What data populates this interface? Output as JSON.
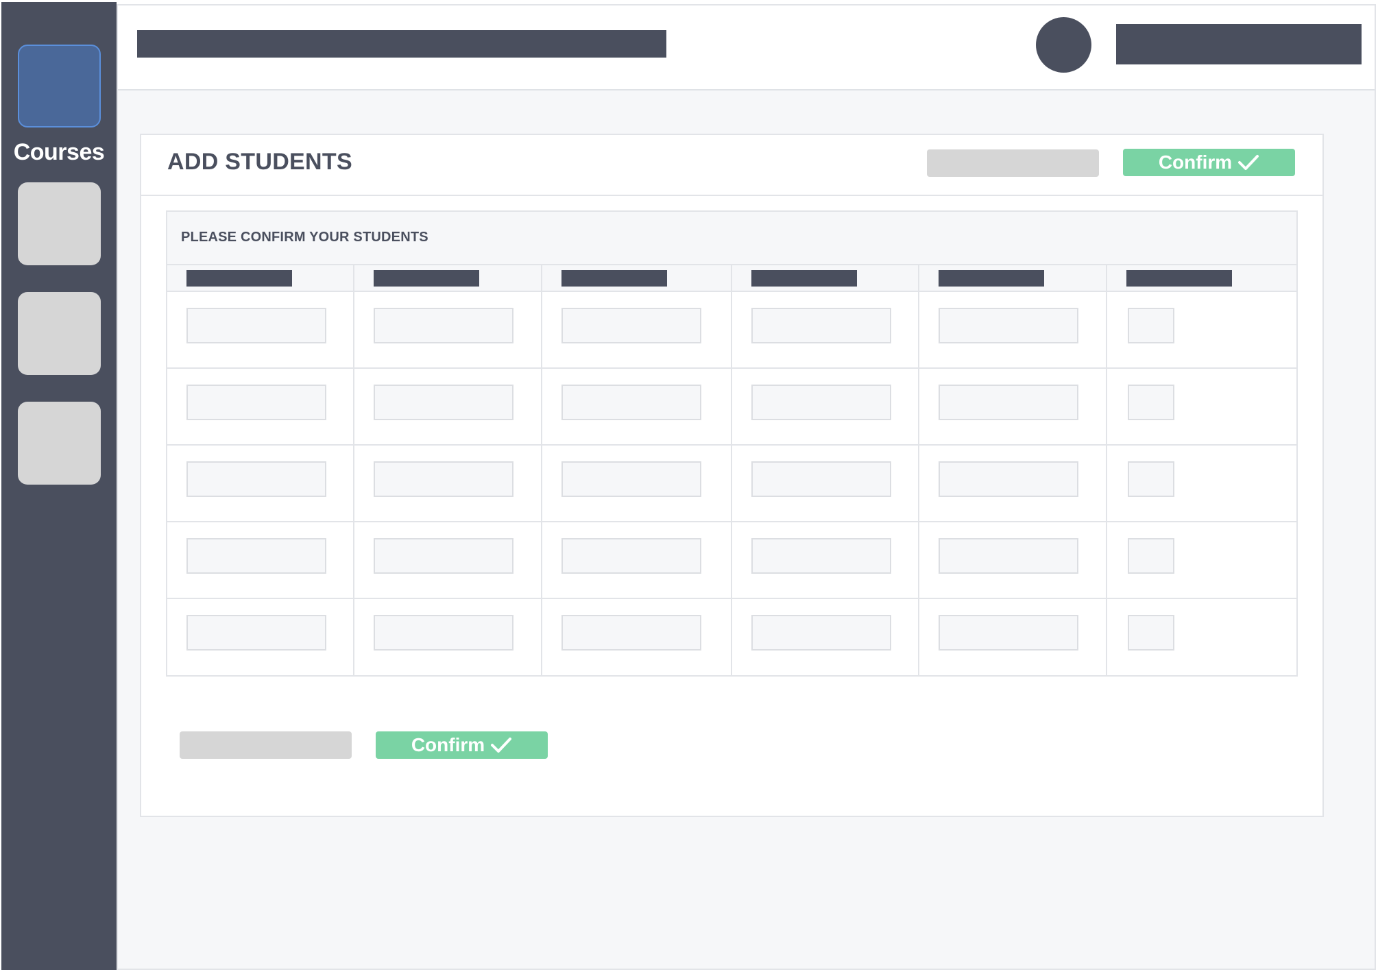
{
  "sidebar": {
    "items": [
      {
        "label": "Courses",
        "active": true
      },
      {
        "label": "",
        "active": false
      },
      {
        "label": "",
        "active": false
      },
      {
        "label": "",
        "active": false
      }
    ]
  },
  "card": {
    "title": "ADD STUDENTS",
    "confirm_label": "Confirm",
    "table_caption": "PLEASE CONFIRM YOUR STUDENTS",
    "columns": 6,
    "rows": 5
  },
  "footer": {
    "confirm_label": "Confirm"
  },
  "colors": {
    "sidebar": "#4a4f5e",
    "accent_green": "#7ad3a4",
    "active_tile": "#4a6899",
    "placeholder_gray": "#d6d6d6"
  },
  "icons": [
    "check-icon"
  ]
}
